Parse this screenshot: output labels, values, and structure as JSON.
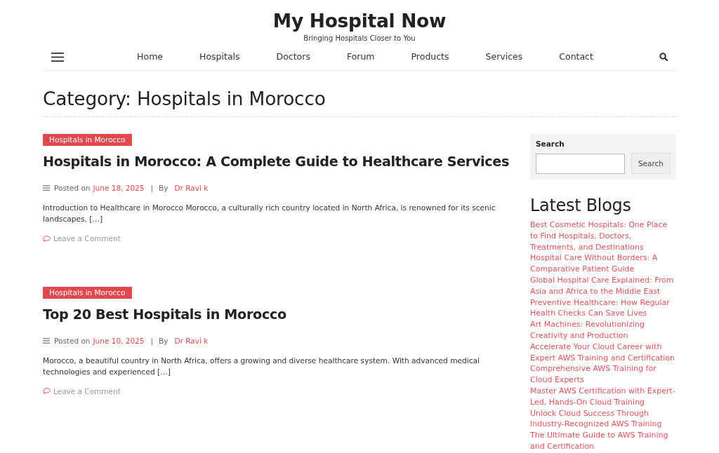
{
  "site": {
    "title": "My Hospital Now",
    "tagline": "Bringing Hospitals Closer to You"
  },
  "nav": {
    "items": [
      "Home",
      "Hospitals",
      "Doctors",
      "Forum",
      "Products",
      "Services",
      "Contact"
    ]
  },
  "page_title": "Category: Hospitals in Morocco",
  "posts": [
    {
      "category": "Hospitals in Morocco",
      "title": "Hospitals in Morocco: A Complete Guide to Healthcare Services",
      "posted_on_label": "Posted on",
      "date": "June 18, 2025",
      "separator": "|",
      "by_label": "By",
      "author": "Dr Ravi k",
      "excerpt": "Introduction to Healthcare in Morocco Morocco, a culturally rich country located in North Africa, is renowned for its scenic landscapes, […]",
      "comment_link": "Leave a Comment"
    },
    {
      "category": "Hospitals in Morocco",
      "title": "Top 20 Best Hospitals in Morocco",
      "posted_on_label": "Posted on",
      "date": "June 10, 2025",
      "separator": "|",
      "by_label": "By",
      "author": "Dr Ravi k",
      "excerpt": "Morocco, a beautiful country in North Africa, offers a growing and diverse healthcare system. With advanced medical technologies and experienced […]",
      "comment_link": "Leave a Comment"
    }
  ],
  "sidebar": {
    "search": {
      "label": "Search",
      "button": "Search"
    },
    "latest_blogs": {
      "title": "Latest Blogs",
      "items": [
        "Best Cosmetic Hospitals: One Place to Find Hospitals, Doctors, Treatments, and Destinations",
        "Hospital Care Without Borders: A Comparative Patient Guide",
        "Global Hospital Care Explained: From Asia and Africa to the Middle East",
        "Preventive Healthcare: How Regular Health Checks Can Save Lives",
        "Art Machines: Revolutionizing Creativity and Production",
        "Accelerate Your Cloud Career with Expert AWS Training and Certification",
        "Comprehensive AWS Training for Cloud Experts",
        "Master AWS Certification with Expert-Led, Hands-On Cloud Training",
        "Unlock Cloud Success Through Industry-Recognized AWS Training",
        "The Ultimate Guide to AWS Training and Certification"
      ]
    }
  }
}
